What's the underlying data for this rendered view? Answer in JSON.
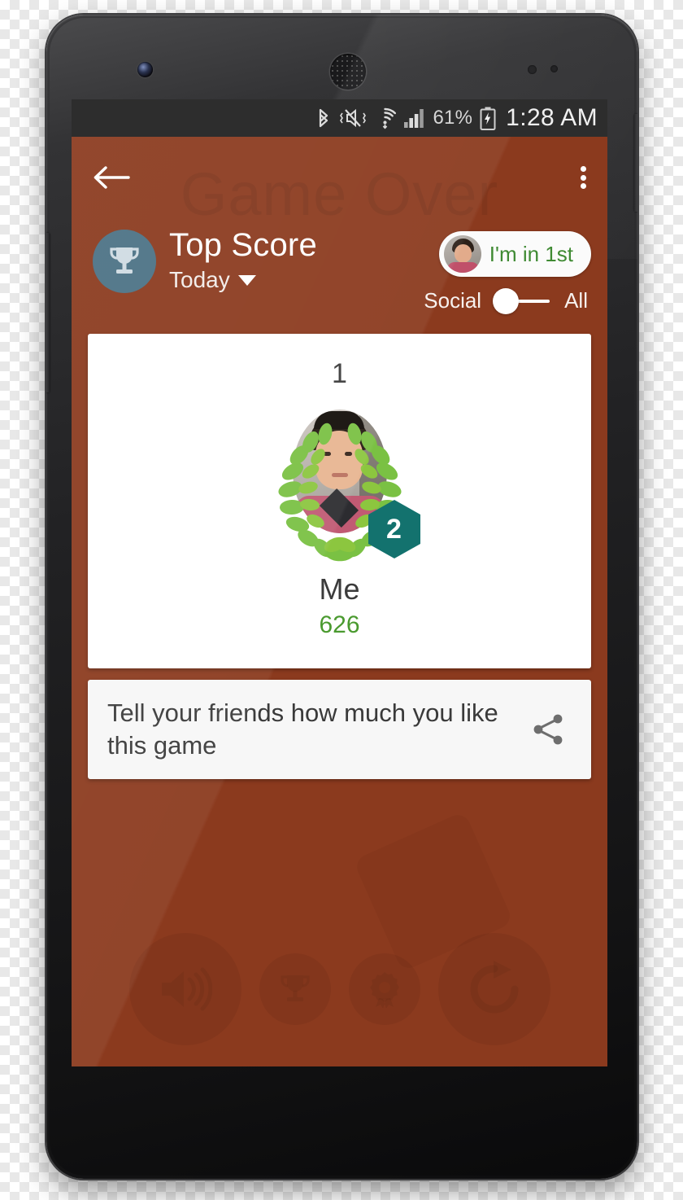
{
  "status_bar": {
    "icons": [
      "bluetooth-icon",
      "volume-mute-vibrate-icon",
      "wifi-icon",
      "cellular-signal-icon",
      "battery-charging-icon"
    ],
    "battery_percent": "61%",
    "clock": "1:28 AM"
  },
  "toolbar": {
    "back_icon": "back-arrow-icon",
    "overflow_icon": "overflow-menu-icon"
  },
  "header": {
    "watermark": "Game Over",
    "trophy_icon": "trophy-icon",
    "title": "Top Score",
    "period": "Today",
    "period_caret_icon": "chevron-down-icon",
    "rank_pill": {
      "avatar": "user-avatar-small",
      "text": "I'm in 1st",
      "text_color": "#3f8a33"
    },
    "scope_toggle": {
      "left_label": "Social",
      "right_label": "All",
      "selected": "Social"
    }
  },
  "leader_card": {
    "rank": "1",
    "avatar": "laurel-wreath-avatar",
    "level_badge": "2",
    "level_badge_color": "#13726e",
    "name": "Me",
    "score": "626",
    "score_color": "#4a9a2f"
  },
  "share_card": {
    "text": "Tell your friends how much you like this game",
    "icon": "share-icon"
  },
  "game_buttons": [
    {
      "name": "sound-button",
      "icon": "volume-up-icon"
    },
    {
      "name": "leaderboard-button",
      "icon": "trophy-icon"
    },
    {
      "name": "achievements-button",
      "icon": "medal-icon"
    },
    {
      "name": "replay-button",
      "icon": "replay-icon"
    }
  ],
  "colors": {
    "app_background": "#8b3a1e",
    "toolbar": "#8b3a1e",
    "card_white": "#ffffff",
    "share_card": "#f7f7f7",
    "trophy_badge": "#4b7184",
    "status_bar": "#2d2d2d"
  }
}
